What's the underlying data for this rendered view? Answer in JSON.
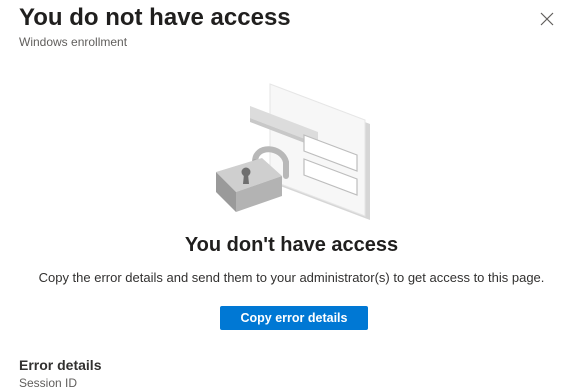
{
  "panel": {
    "title": "You do not have access",
    "subtitle": "Windows enrollment",
    "close_icon": "close-icon"
  },
  "main": {
    "illustration_icon": "lock-card-illustration",
    "heading": "You don't have access",
    "description": "Copy the error details and send them to your administrator(s) to get access to this page.",
    "copy_button_label": "Copy error details"
  },
  "error_details": {
    "title": "Error details",
    "session_id_label": "Session ID"
  },
  "colors": {
    "accent": "#0078d4",
    "title_text": "#201f1e",
    "secondary_text": "#605e5c"
  }
}
